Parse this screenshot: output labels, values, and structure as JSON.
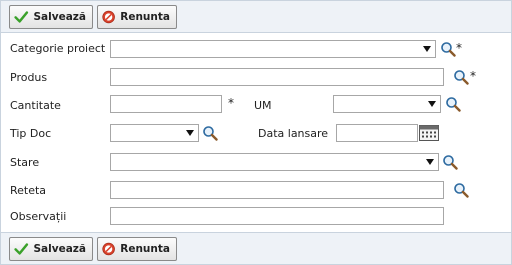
{
  "toolbar": {
    "save_label": "Salvează",
    "cancel_label": "Renunta"
  },
  "form": {
    "categorie_label": "Categorie proiect",
    "produs_label": "Produs",
    "cantitate_label": "Cantitate",
    "um_label": "UM",
    "tip_doc_label": "Tip Doc",
    "data_lansare_label": "Data lansare",
    "stare_label": "Stare",
    "reteta_label": "Reteta",
    "observatii_label": "Observații",
    "required_mark": "*",
    "categorie_value": "",
    "produs_value": "",
    "cantitate_value": "",
    "um_value": "",
    "tip_doc_value": "",
    "data_lansare_value": "",
    "stare_value": "",
    "reteta_value": "",
    "observatii_value": ""
  },
  "icons": {
    "save": "check-icon",
    "cancel": "cancel-icon",
    "lookup": "magnifier-icon",
    "calendar": "calendar-icon"
  },
  "colors": {
    "toolbar_bg": "#eef2f7",
    "check_green": "#3aa12a",
    "cancel_red": "#d9412b"
  }
}
